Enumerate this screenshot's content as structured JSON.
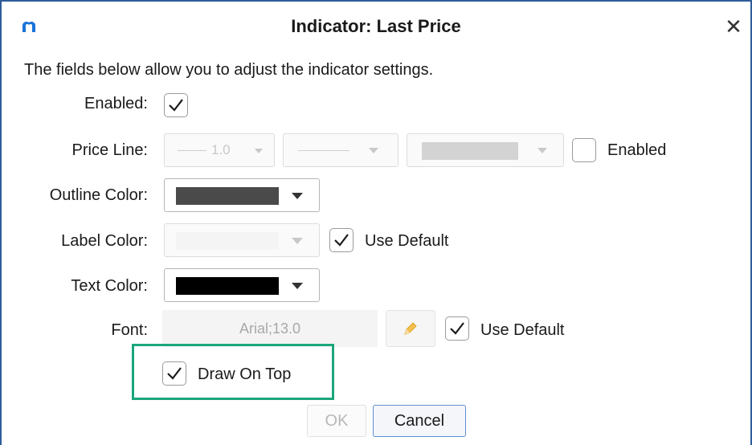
{
  "window": {
    "title": "Indicator: Last Price",
    "close_symbol": "✕"
  },
  "description": "The fields below allow you to adjust the indicator settings.",
  "fields": {
    "enabled": {
      "label": "Enabled:",
      "checked": true
    },
    "price_line": {
      "label": "Price Line:",
      "width_value": "1.0",
      "enabled_label": "Enabled",
      "enabled_checked": false
    },
    "outline_color": {
      "label": "Outline Color:",
      "color": "#4a4a4a"
    },
    "label_color": {
      "label": "Label Color:",
      "use_default_label": "Use Default",
      "use_default_checked": true
    },
    "text_color": {
      "label": "Text Color:",
      "color": "#000000"
    },
    "font": {
      "label": "Font:",
      "value": "Arial;13.0",
      "use_default_label": "Use Default",
      "use_default_checked": true
    },
    "draw_on_top": {
      "label": "Draw On Top",
      "checked": true
    }
  },
  "buttons": {
    "ok": "OK",
    "cancel": "Cancel"
  },
  "colors": {
    "accent_border": "#2e5c9a",
    "highlight": "#1aa67d",
    "logo": "#1a73d9"
  }
}
